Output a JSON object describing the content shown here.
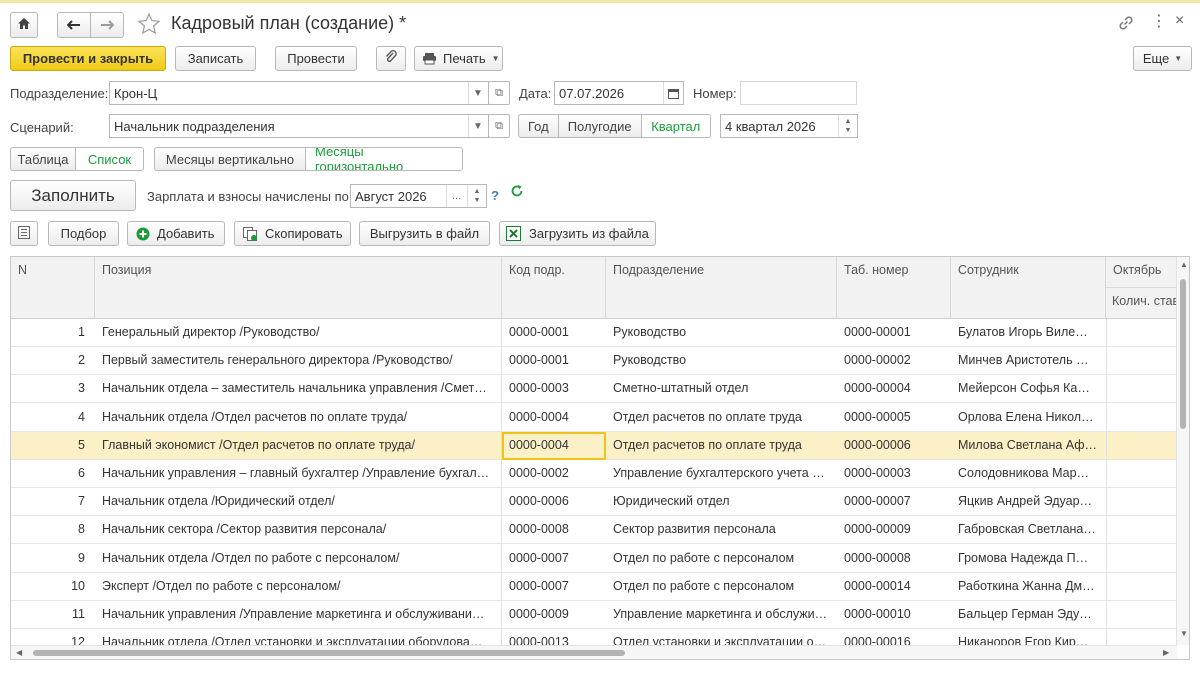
{
  "window": {
    "title": "Кадровый план (создание) *"
  },
  "toolbar": {
    "post_close": "Провести и закрыть",
    "write": "Записать",
    "post": "Провести",
    "print": "Печать",
    "more": "Еще"
  },
  "form": {
    "division_label": "Подразделение:",
    "division_value": "Крон-Ц",
    "date_label": "Дата:",
    "date_value": "07.07.2026",
    "number_label": "Номер:",
    "number_value": "",
    "scenario_label": "Сценарий:",
    "scenario_value": "Начальник подразделения",
    "period_year": "Год",
    "period_half": "Полугодие",
    "period_quarter": "Квартал",
    "period_value": "4 квартал 2026"
  },
  "view": {
    "table": "Таблица",
    "list": "Список",
    "months_vertical": "Месяцы вертикально",
    "months_horizontal": "Месяцы горизонтально"
  },
  "fill": {
    "fill_button": "Заполнить",
    "salary_label": "Зарплата и взносы начислены по:",
    "salary_value": "Август 2026",
    "help": "?"
  },
  "table_toolbar": {
    "pick": "Подбор",
    "add": "Добавить",
    "copy": "Скопировать",
    "export": "Выгрузить в файл",
    "import": "Загрузить из файла"
  },
  "table": {
    "headers": {
      "n": "N",
      "position": "Позиция",
      "code": "Код подр.",
      "division": "Подразделение",
      "tab": "Таб. номер",
      "employee": "Сотрудник",
      "month": "Октябрь",
      "month_sub": "Колич. став"
    },
    "rows": [
      {
        "n": "1",
        "position": "Генеральный директор /Руководство/",
        "code": "0000-0001",
        "division": "Руководство",
        "tab": "0000-00001",
        "employee": "Булатов Игорь Виле…"
      },
      {
        "n": "2",
        "position": "Первый заместитель генерального директора /Руководство/",
        "code": "0000-0001",
        "division": "Руководство",
        "tab": "0000-00002",
        "employee": "Минчев Аристотель …"
      },
      {
        "n": "3",
        "position": "Начальник отдела – заместитель начальника управления /Смет…",
        "code": "0000-0003",
        "division": "Сметно-штатный отдел",
        "tab": "0000-00004",
        "employee": "Мейерсон Софья Ка…"
      },
      {
        "n": "4",
        "position": "Начальник отдела /Отдел расчетов по оплате труда/",
        "code": "0000-0004",
        "division": "Отдел расчетов по оплате труда",
        "tab": "0000-00005",
        "employee": "Орлова Елена Никол…"
      },
      {
        "n": "5",
        "position": "Главный экономист /Отдел расчетов по оплате труда/",
        "code": "0000-0004",
        "division": "Отдел расчетов по оплате труда",
        "tab": "0000-00006",
        "employee": "Милова Светлана Аф…"
      },
      {
        "n": "6",
        "position": "Начальник управления – главный бухгалтер /Управление бухгал…",
        "code": "0000-0002",
        "division": "Управление бухгалтерского учета …",
        "tab": "0000-00003",
        "employee": "Солодовникова Мар…"
      },
      {
        "n": "7",
        "position": "Начальник отдела /Юридический отдел/",
        "code": "0000-0006",
        "division": "Юридический отдел",
        "tab": "0000-00007",
        "employee": "Яцкив Андрей Эдуар…"
      },
      {
        "n": "8",
        "position": "Начальник сектора /Сектор развития персонала/",
        "code": "0000-0008",
        "division": "Сектор развития персонала",
        "tab": "0000-00009",
        "employee": "Габровская Светлана…"
      },
      {
        "n": "9",
        "position": "Начальник отдела /Отдел по работе с персоналом/",
        "code": "0000-0007",
        "division": "Отдел по работе с персоналом",
        "tab": "0000-00008",
        "employee": "Громова Надежда П…"
      },
      {
        "n": "10",
        "position": "Эксперт /Отдел по работе с персоналом/",
        "code": "0000-0007",
        "division": "Отдел по работе с персоналом",
        "tab": "0000-00014",
        "employee": "Работкина Жанна Дм…"
      },
      {
        "n": "11",
        "position": "Начальник управления /Управление маркетинга и обслуживани…",
        "code": "0000-0009",
        "division": "Управление маркетинга и обслужи…",
        "tab": "0000-00010",
        "employee": "Бальцер Герман Эду…"
      },
      {
        "n": "12",
        "position": "Начальник отдела /Отдел установки и эксплуатации оборудова…",
        "code": "0000-0013",
        "division": "Отдел установки и эксплуатации о…",
        "tab": "0000-00016",
        "employee": "Никаноров Егор Кир…"
      }
    ]
  },
  "colors": {
    "primary_button": "#f0cb13",
    "selected_row": "#fbf0c6",
    "active_green": "#1d9a3a"
  }
}
